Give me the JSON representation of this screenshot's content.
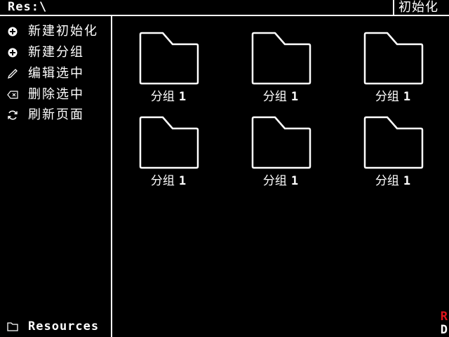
{
  "topbar": {
    "path": "Res:\\",
    "init_label": "初始化"
  },
  "sidebar": {
    "items": [
      {
        "label": "新建初始化",
        "icon": "plus-circle-icon"
      },
      {
        "label": "新建分组",
        "icon": "plus-circle-icon"
      },
      {
        "label": "编辑选中",
        "icon": "pencil-icon"
      },
      {
        "label": "删除选中",
        "icon": "backspace-icon"
      },
      {
        "label": "刷新页面",
        "icon": "refresh-icon"
      }
    ],
    "resources_label": "Resources",
    "resources_icon": "folder-icon"
  },
  "folders": [
    {
      "name": "分组",
      "number": "1"
    },
    {
      "name": "分组",
      "number": "1"
    },
    {
      "name": "分组",
      "number": "1"
    },
    {
      "name": "分组",
      "number": "1"
    },
    {
      "name": "分组",
      "number": "1"
    },
    {
      "name": "分组",
      "number": "1"
    }
  ],
  "corner": {
    "top_letter": "R",
    "bottom_letter": "D"
  },
  "colors": {
    "background": "#000000",
    "foreground": "#ffffff",
    "accent_red": "#e0141b"
  }
}
